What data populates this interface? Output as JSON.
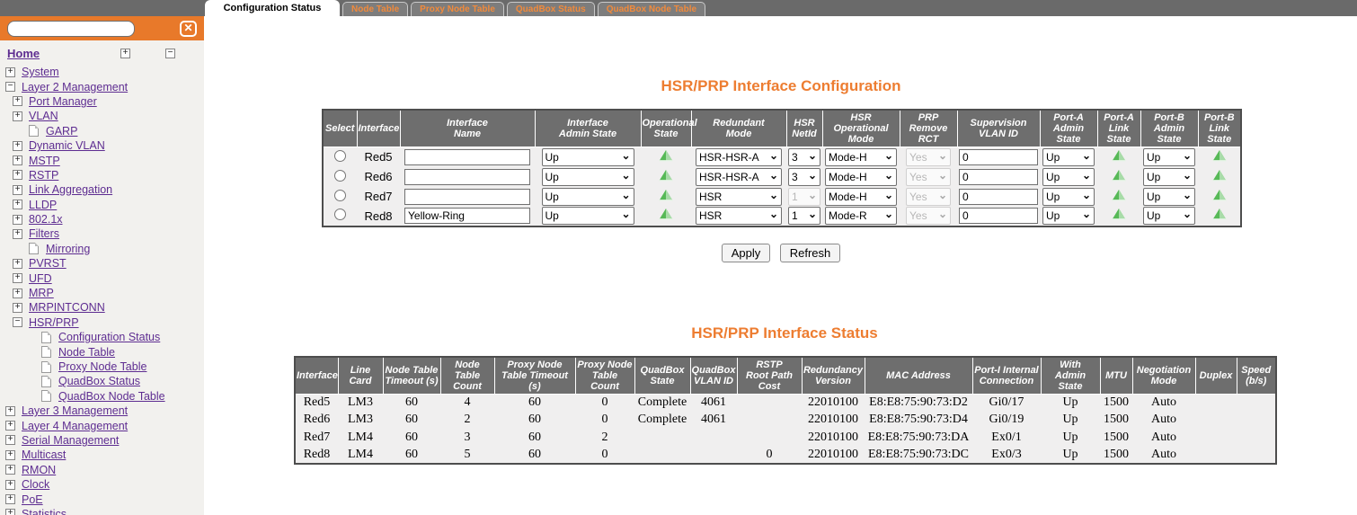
{
  "icons": {
    "close": "✕",
    "expand": "+",
    "collapse": "−",
    "state_up": "green-triangle-up"
  },
  "colors": {
    "accent_orange": "#E8792A",
    "title_orange": "#ED7D31",
    "bar_gray": "#6A6A6A",
    "header_gray": "#6E6E6E",
    "link_purple": "#5E2D91",
    "state_green": "#57B957"
  },
  "tabs": [
    {
      "label": "Configuration Status",
      "active": true
    },
    {
      "label": "Node Table",
      "active": false
    },
    {
      "label": "Proxy Node Table",
      "active": false
    },
    {
      "label": "QuadBox Status",
      "active": false
    },
    {
      "label": "QuadBox Node Table",
      "active": false
    }
  ],
  "sidebar": {
    "search_value": "",
    "home": {
      "label": "Home"
    },
    "tree": [
      {
        "label": "System",
        "level": 0,
        "glyph": "plus"
      },
      {
        "label": "Layer 2 Management",
        "level": 0,
        "glyph": "minus"
      },
      {
        "label": "Port Manager",
        "level": 1,
        "glyph": "plus"
      },
      {
        "label": "VLAN",
        "level": 1,
        "glyph": "plus"
      },
      {
        "label": "GARP",
        "level": 2,
        "glyph": "file"
      },
      {
        "label": "Dynamic VLAN",
        "level": 1,
        "glyph": "plus"
      },
      {
        "label": "MSTP",
        "level": 1,
        "glyph": "plus"
      },
      {
        "label": "RSTP",
        "level": 1,
        "glyph": "plus"
      },
      {
        "label": "Link Aggregation",
        "level": 1,
        "glyph": "plus"
      },
      {
        "label": "LLDP",
        "level": 1,
        "glyph": "plus"
      },
      {
        "label": "802.1x",
        "level": 1,
        "glyph": "plus"
      },
      {
        "label": "Filters",
        "level": 1,
        "glyph": "plus"
      },
      {
        "label": "Mirroring",
        "level": 2,
        "glyph": "file"
      },
      {
        "label": "PVRST",
        "level": 1,
        "glyph": "plus"
      },
      {
        "label": "UFD",
        "level": 1,
        "glyph": "plus"
      },
      {
        "label": "MRP",
        "level": 1,
        "glyph": "plus"
      },
      {
        "label": "MRPINTCONN",
        "level": 1,
        "glyph": "plus"
      },
      {
        "label": "HSR/PRP",
        "level": 1,
        "glyph": "minus"
      },
      {
        "label": "Configuration Status",
        "level": 3,
        "glyph": "file"
      },
      {
        "label": "Node Table",
        "level": 3,
        "glyph": "file"
      },
      {
        "label": "Proxy Node Table",
        "level": 3,
        "glyph": "file"
      },
      {
        "label": "QuadBox Status",
        "level": 3,
        "glyph": "file"
      },
      {
        "label": "QuadBox Node Table",
        "level": 3,
        "glyph": "file"
      },
      {
        "label": "Layer 3 Management",
        "level": 0,
        "glyph": "plus"
      },
      {
        "label": "Layer 4 Management",
        "level": 0,
        "glyph": "plus"
      },
      {
        "label": "Serial Management",
        "level": 0,
        "glyph": "plus"
      },
      {
        "label": "Multicast",
        "level": 0,
        "glyph": "plus"
      },
      {
        "label": "RMON",
        "level": 0,
        "glyph": "plus"
      },
      {
        "label": "Clock",
        "level": 0,
        "glyph": "plus"
      },
      {
        "label": "PoE",
        "level": 0,
        "glyph": "plus"
      },
      {
        "label": "Statistics",
        "level": 0,
        "glyph": "plus"
      }
    ]
  },
  "config": {
    "title": "HSR/PRP Interface Configuration",
    "columns": [
      "Select",
      "Interface",
      "Interface\nName",
      "Interface\nAdmin State",
      "Operational\nState",
      "Redundant\nMode",
      "HSR\nNetId",
      "HSR\nOperational Mode",
      "PRP\nRemove RCT",
      "Supervision\nVLAN ID",
      "Port-A\nAdmin State",
      "Port-A\nLink State",
      "Port-B\nAdmin State",
      "Port-B\nLink State"
    ],
    "rows": [
      {
        "interface": "Red5",
        "name": "",
        "admin_state": "Up",
        "operational_state": "up",
        "redundant_mode": "HSR-HSR-A",
        "hsr_netid": "3",
        "hsr_netid_disabled": false,
        "hsr_operational_mode": "Mode-H",
        "prp_remove_rct": "Yes",
        "prp_remove_rct_disabled": true,
        "supervision_vlan_id": "0",
        "port_a_admin_state": "Up",
        "port_a_link_state": "up",
        "port_b_admin_state": "Up",
        "port_b_link_state": "up"
      },
      {
        "interface": "Red6",
        "name": "",
        "admin_state": "Up",
        "operational_state": "up",
        "redundant_mode": "HSR-HSR-A",
        "hsr_netid": "3",
        "hsr_netid_disabled": false,
        "hsr_operational_mode": "Mode-H",
        "prp_remove_rct": "Yes",
        "prp_remove_rct_disabled": true,
        "supervision_vlan_id": "0",
        "port_a_admin_state": "Up",
        "port_a_link_state": "up",
        "port_b_admin_state": "Up",
        "port_b_link_state": "up"
      },
      {
        "interface": "Red7",
        "name": "",
        "admin_state": "Up",
        "operational_state": "up",
        "redundant_mode": "HSR",
        "hsr_netid": "1",
        "hsr_netid_disabled": true,
        "hsr_operational_mode": "Mode-H",
        "prp_remove_rct": "Yes",
        "prp_remove_rct_disabled": true,
        "supervision_vlan_id": "0",
        "port_a_admin_state": "Up",
        "port_a_link_state": "up",
        "port_b_admin_state": "Up",
        "port_b_link_state": "up"
      },
      {
        "interface": "Red8",
        "name": "Yellow-Ring",
        "admin_state": "Up",
        "operational_state": "up",
        "redundant_mode": "HSR",
        "hsr_netid": "1",
        "hsr_netid_disabled": false,
        "hsr_operational_mode": "Mode-R",
        "prp_remove_rct": "Yes",
        "prp_remove_rct_disabled": true,
        "supervision_vlan_id": "0",
        "port_a_admin_state": "Up",
        "port_a_link_state": "up",
        "port_b_admin_state": "Up",
        "port_b_link_state": "up"
      }
    ],
    "apply_label": "Apply",
    "refresh_label": "Refresh"
  },
  "status": {
    "title": "HSR/PRP Interface Status",
    "columns": [
      "Interface",
      "Line Card",
      "Node Table\nTimeout (s)",
      "Node Table\nCount",
      "Proxy Node\nTable Timeout (s)",
      "Proxy Node\nTable Count",
      "QuadBox\nState",
      "QuadBox\nVLAN ID",
      "RSTP\nRoot Path Cost",
      "Redundancy\nVersion",
      "MAC Address",
      "Port-I Internal\nConnection",
      "With\nAdmin State",
      "MTU",
      "Negotiation\nMode",
      "Duplex",
      "Speed\n(b/s)"
    ],
    "rows": [
      [
        "Red5",
        "LM3",
        "60",
        "4",
        "60",
        "0",
        "Complete",
        "4061",
        "",
        "22010100",
        "E8:E8:75:90:73:D2",
        "Gi0/17",
        "Up",
        "1500",
        "Auto",
        "",
        ""
      ],
      [
        "Red6",
        "LM3",
        "60",
        "2",
        "60",
        "0",
        "Complete",
        "4061",
        "",
        "22010100",
        "E8:E8:75:90:73:D4",
        "Gi0/19",
        "Up",
        "1500",
        "Auto",
        "",
        ""
      ],
      [
        "Red7",
        "LM4",
        "60",
        "3",
        "60",
        "2",
        "",
        "",
        "",
        "22010100",
        "E8:E8:75:90:73:DA",
        "Ex0/1",
        "Up",
        "1500",
        "Auto",
        "",
        ""
      ],
      [
        "Red8",
        "LM4",
        "60",
        "5",
        "60",
        "0",
        "",
        "",
        "0",
        "22010100",
        "E8:E8:75:90:73:DC",
        "Ex0/3",
        "Up",
        "1500",
        "Auto",
        "",
        ""
      ]
    ]
  }
}
